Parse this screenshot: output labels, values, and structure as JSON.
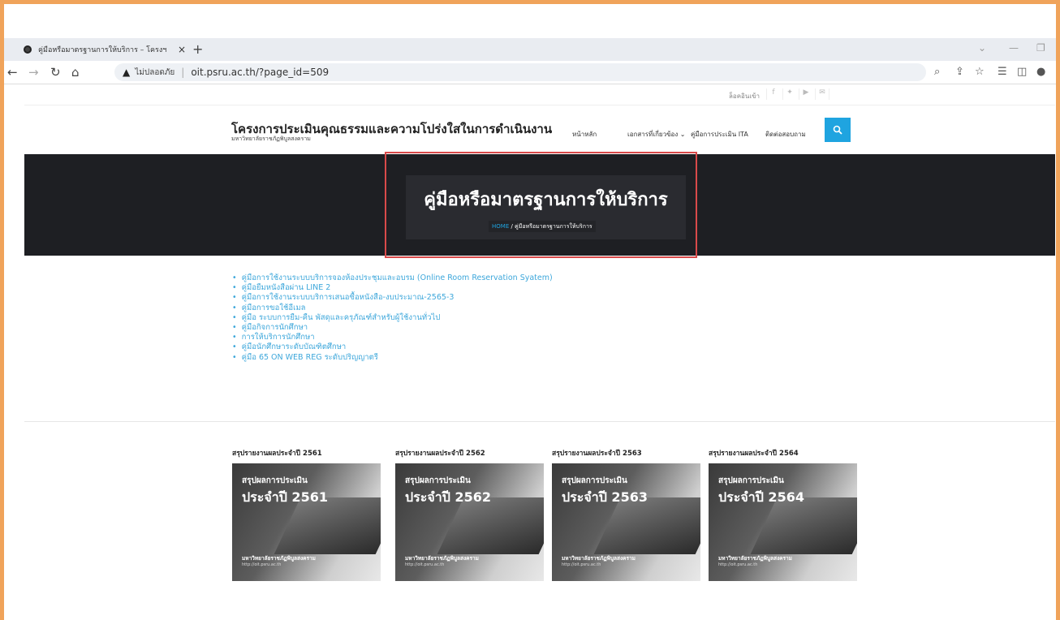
{
  "browser": {
    "tab_title": "คู่มือหรือมาตรฐานการให้บริการ – โครงฯ",
    "tab_close": "×",
    "new_tab": "+",
    "insecure_label": "ไม่ปลอดภัย",
    "url": "oit.psru.ac.th/?page_id=509"
  },
  "topbar": {
    "login": "ล็อคอินเข้า",
    "social_icons": [
      "facebook-icon",
      "twitter-icon",
      "youtube-icon",
      "mail-icon"
    ]
  },
  "header": {
    "title": "โครงการประเมินคุณธรรมและความโปร่งใสในการดำเนินงาน",
    "subtitle": "มหาวิทยาลัยราชภัฏพิบูลสงคราม",
    "menu": [
      "หน้าหลัก",
      "เอกสารที่เกี่ยวข้อง ⌄",
      "คู่มือการประเมิน ITA",
      "ติดต่อสอบถาม"
    ]
  },
  "banner": {
    "title": "คู่มือหรือมาตรฐานการให้บริการ",
    "crumb_home": "HOME",
    "crumb_current": " / คู่มือหรือมาตรฐานการให้บริการ"
  },
  "links": [
    "คู่มือการใช้งานระบบบริการจองห้องประชุมและอบรม (Online Room Reservation Syatem)",
    "คู่มือยืมหนังสือผ่าน LINE 2",
    "คู่มือการใช้งานระบบบริการเสนอซื้อหนังสือ-งบประมาณ-2565-3",
    "คู่มือการขอใช้อีเมล",
    "คู่มือ ระบบการยืม-คืน พัสดุและครุภัณฑ์สำหรับผู้ใช้งานทั่วไป",
    "คู่มือกิจการนักศึกษา",
    "การให้บริการนักศึกษา",
    "คู่มือนักศึกษาระดับบัณฑิตศึกษา",
    "คู่มือ 65 ON WEB REG ระดับปริญญาตรี"
  ],
  "reports": [
    {
      "title": "สรุปรายงานผลประจำปี 2561",
      "line1": "สรุปผลการประเมิน",
      "line2": "ประจำปี 2561",
      "line3": "มหาวิทยาลัยราชภัฏพิบูลสงคราม",
      "line4": "http://oit.psru.ac.th"
    },
    {
      "title": "สรุปรายงานผลประจำปี 2562",
      "line1": "สรุปผลการประเมิน",
      "line2": "ประจำปี 2562",
      "line3": "มหาวิทยาลัยราชภัฏพิบูลสงคราม",
      "line4": "http://oit.psru.ac.th"
    },
    {
      "title": "สรุปรายงานผลประจำปี 2563",
      "line1": "สรุปผลการประเมิน",
      "line2": "ประจำปี 2563",
      "line3": "มหาวิทยาลัยราชภัฏพิบูลสงคราม",
      "line4": "http://oit.psru.ac.th"
    },
    {
      "title": "สรุปรายงานผลประจำปี 2564",
      "line1": "สรุปผลการประเมิน",
      "line2": "ประจำปี 2564",
      "line3": "มหาวิทยาลัยราชภัฏพิบูลสงคราม",
      "line4": "http://oit.psru.ac.th"
    }
  ],
  "colors": {
    "accent": "#1fa4e0",
    "banner_bg": "#1e1f23",
    "highlight": "#d94a4a",
    "frame": "#f0a35a"
  }
}
